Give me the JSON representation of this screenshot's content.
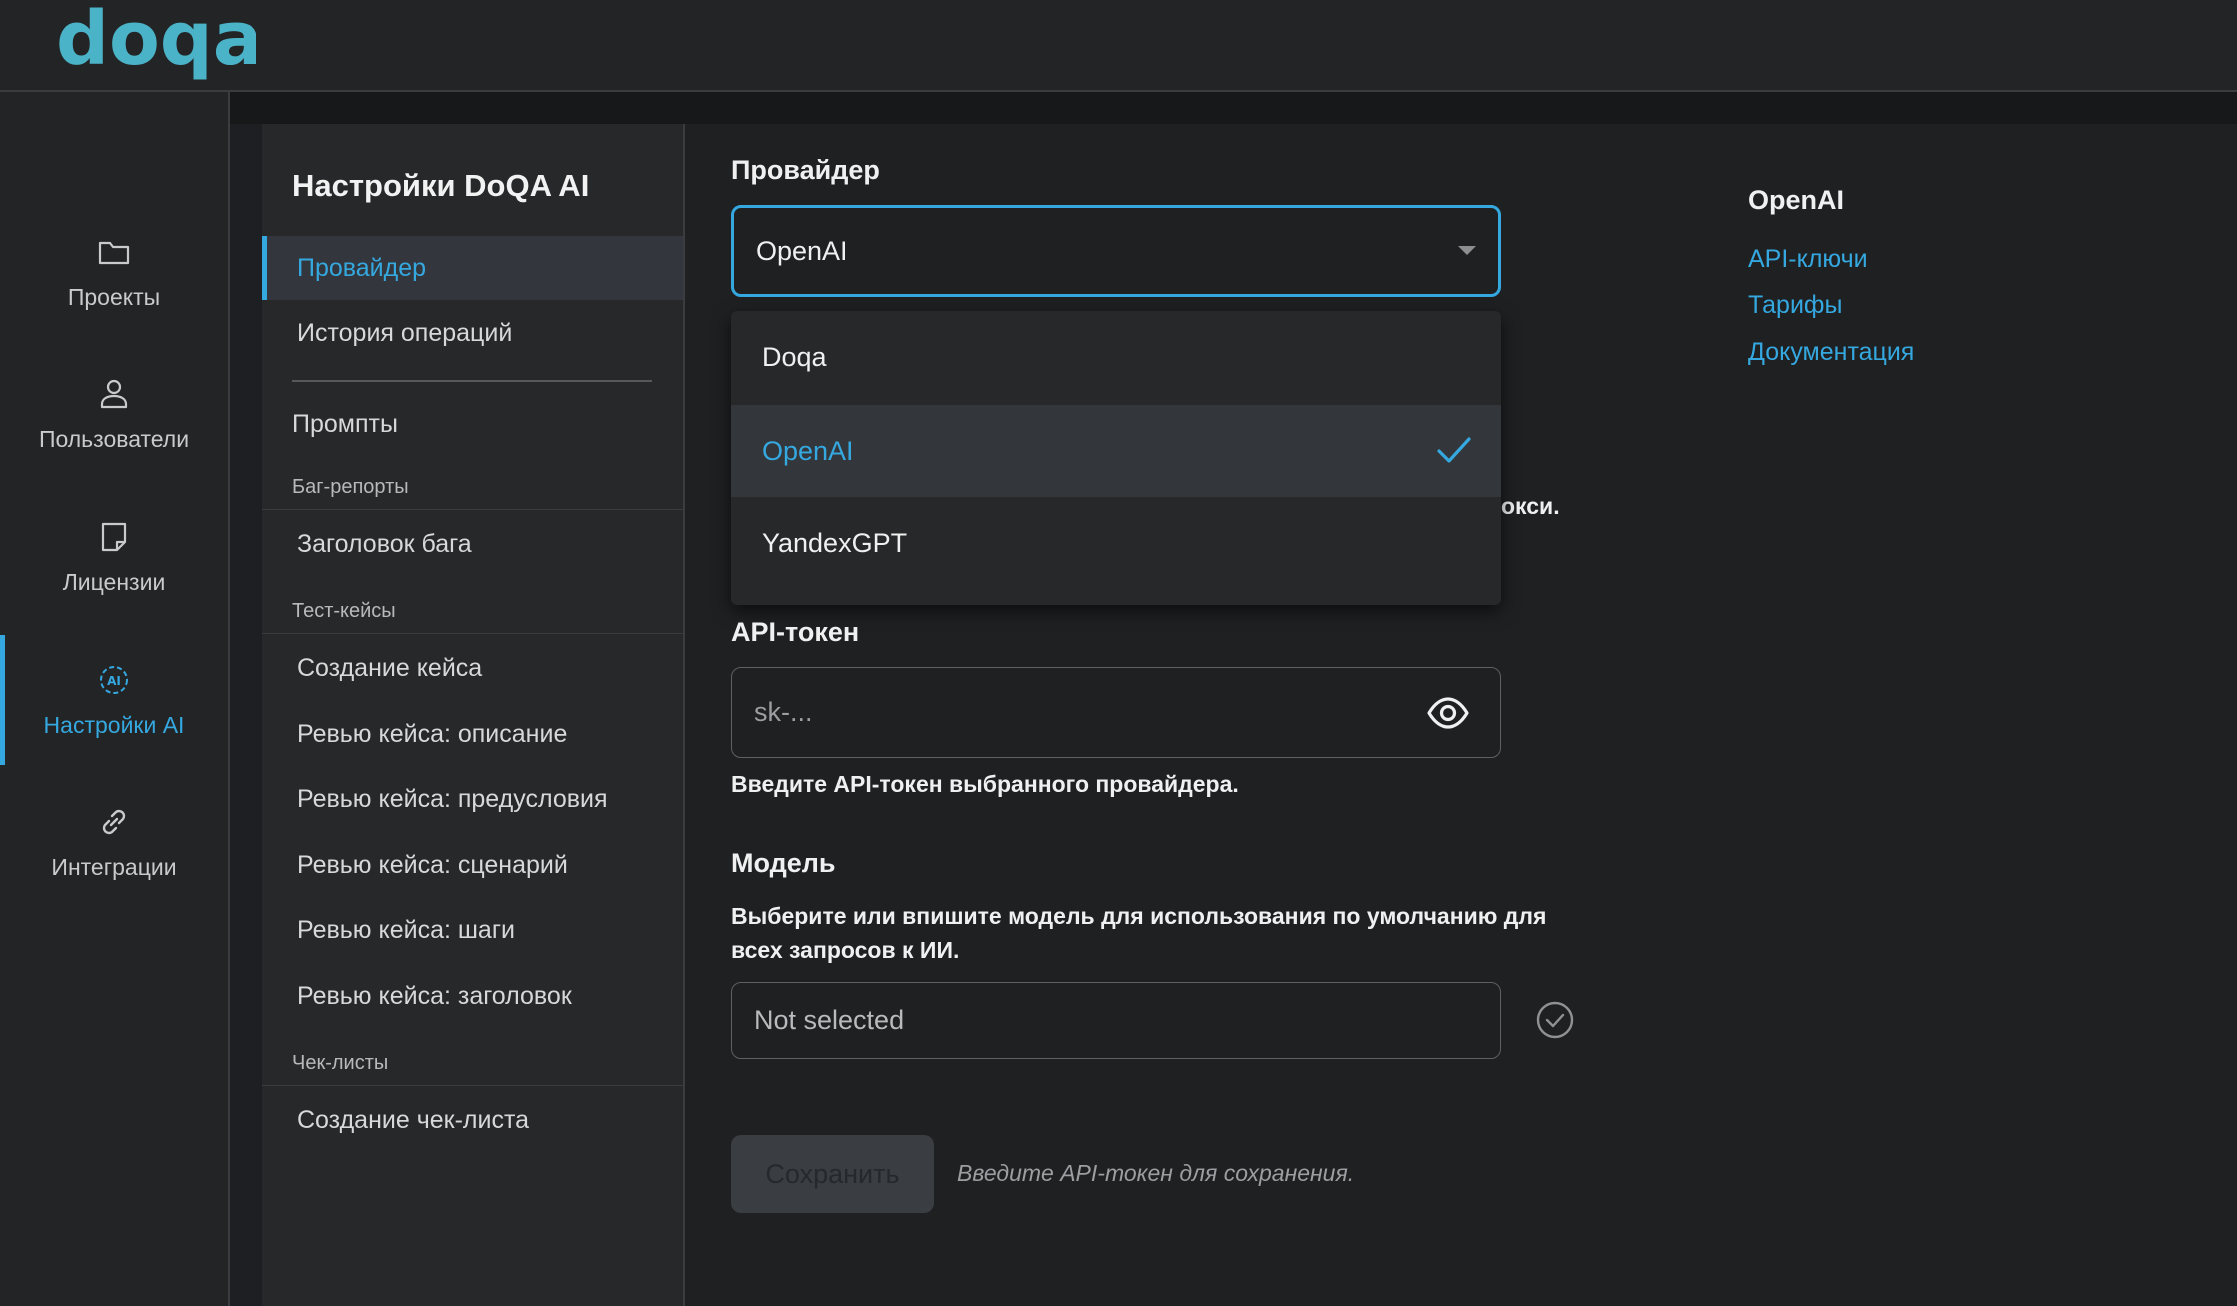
{
  "app": {
    "logo_text": "doqa"
  },
  "nav": {
    "items": [
      {
        "label": "Проекты",
        "icon": "folder-icon"
      },
      {
        "label": "Пользователи",
        "icon": "user-icon"
      },
      {
        "label": "Лицензии",
        "icon": "license-icon"
      },
      {
        "label": "Настройки AI",
        "icon": "ai-icon",
        "active": true
      },
      {
        "label": "Интеграции",
        "icon": "link-icon"
      }
    ]
  },
  "settings_menu": {
    "title": "Настройки DoQA AI",
    "items": {
      "provider": "Провайдер",
      "history": "История операций",
      "prompts": "Промпты"
    },
    "groups": {
      "bug_reports": "Баг-репорты",
      "test_cases": "Тест-кейсы",
      "checklists": "Чек-листы"
    },
    "bug_items": [
      "Заголовок бага"
    ],
    "case_items": [
      "Создание кейса",
      "Ревью кейса: описание",
      "Ревью кейса: предусловия",
      "Ревью кейса: сценарий",
      "Ревью кейса: шаги",
      "Ревью кейса: заголовок"
    ],
    "checklist_items": [
      "Создание чек-листа"
    ]
  },
  "form": {
    "provider_label": "Провайдер",
    "provider_value": "OpenAI",
    "provider_options": [
      "Doqa",
      "OpenAI",
      "YandexGPT"
    ],
    "provider_selected_index": 1,
    "hidden_text_tail": "окси.",
    "token_label": "API-токен",
    "token_placeholder": "sk-...",
    "token_help": "Введите API-токен выбранного провайдера.",
    "model_label": "Модель",
    "model_help_line1": "Выберите или впишите модель для использования по умолчанию для",
    "model_help_line2": "всех запросов к ИИ.",
    "model_placeholder": "Not selected",
    "save_label": "Сохранить",
    "save_hint": "Введите API-токен для сохранения."
  },
  "side_panel": {
    "title": "OpenAI",
    "links": [
      "API-ключи",
      "Тарифы",
      "Документация"
    ]
  },
  "colors": {
    "accent": "#35a8e0",
    "logo": "#4bb3c7",
    "background": "#1d1f22"
  }
}
